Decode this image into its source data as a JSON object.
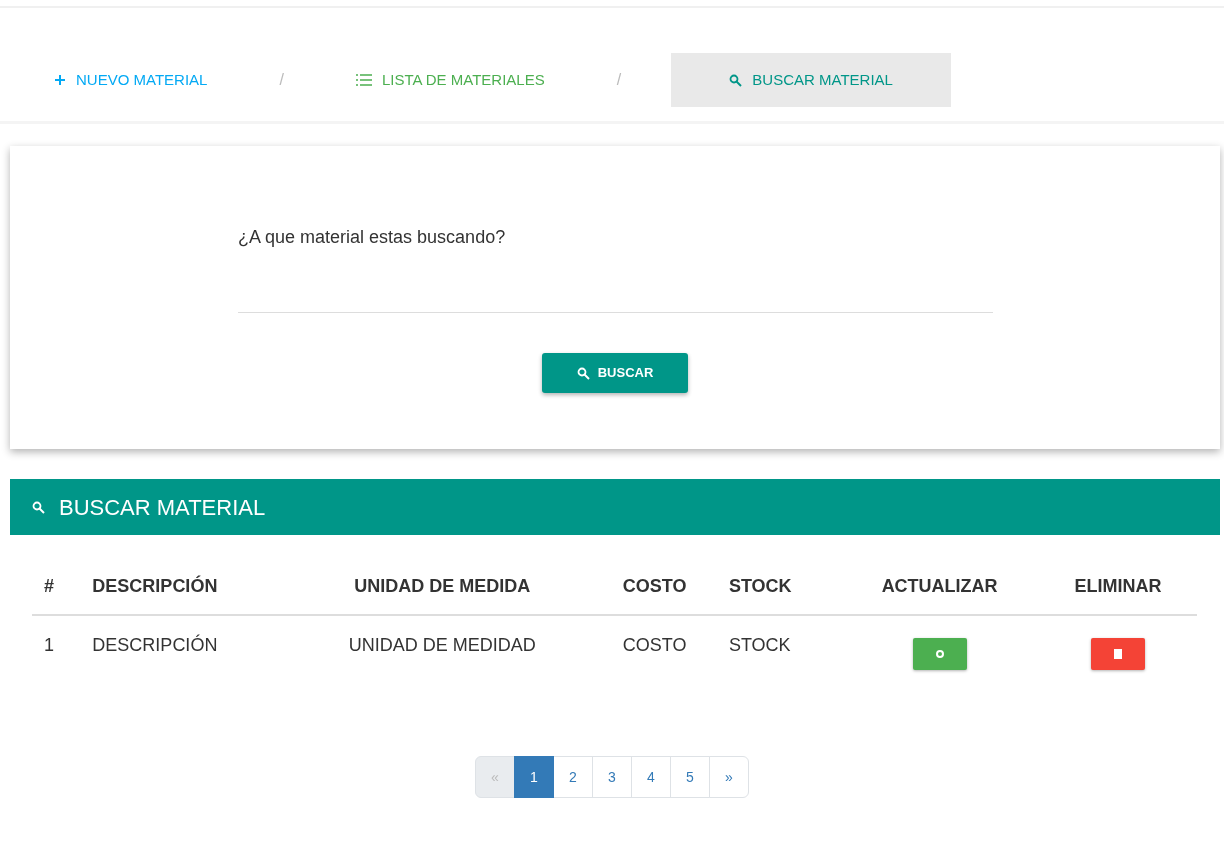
{
  "breadcrumb": [
    {
      "label": "NUEVO MATERIAL",
      "kind": "plus",
      "color": "#03a9f4",
      "selected": false
    },
    {
      "label": "LISTA DE MATERIALES",
      "kind": "list",
      "color": "#4caf50",
      "selected": false
    },
    {
      "label": "BUSCAR MATERIAL",
      "kind": "search",
      "color": "#009688",
      "selected": true
    }
  ],
  "separators": [
    "/",
    "/"
  ],
  "search_form": {
    "label": "¿A que material estas buscando?",
    "button": "BUSCAR"
  },
  "results_panel": {
    "title": "BUSCAR MATERIAL",
    "table": {
      "columns": [
        "#",
        "DESCRIPCIÓN",
        "UNIDAD DE MEDIDA",
        "COSTO",
        "STOCK",
        "ACTUALIZAR",
        "ELIMINAR"
      ],
      "rows": [
        {
          "cells": [
            "1",
            "DESCRIPCIÓN",
            "UNIDAD DE MEDIDAD",
            "COSTO",
            "STOCK"
          ]
        }
      ]
    }
  },
  "pagination": {
    "previous": "«",
    "next": "»",
    "pages": [
      {
        "label": "1",
        "selected": true
      },
      {
        "label": "2",
        "selected": false
      },
      {
        "label": "3",
        "selected": false
      },
      {
        "label": "4",
        "selected": false
      },
      {
        "label": "5",
        "selected": false
      }
    ]
  }
}
